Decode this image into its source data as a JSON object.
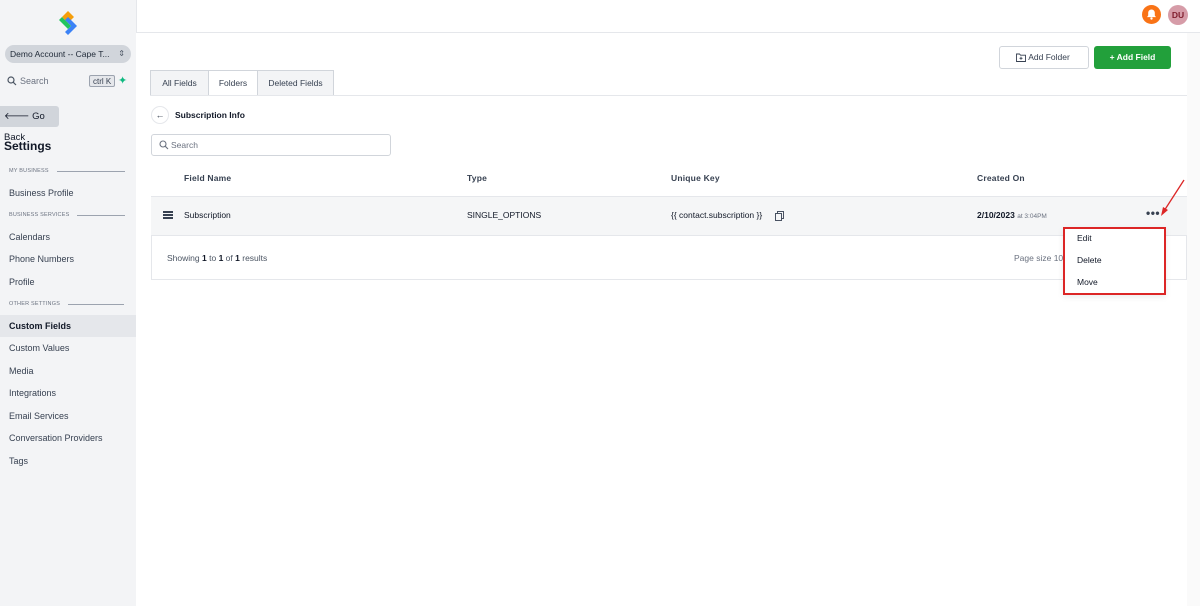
{
  "sidebar": {
    "account_name": "Demo Account -- Cape T...",
    "search_placeholder": "Search",
    "search_shortcut": "ctrl K",
    "go_back": "Go Back",
    "settings_title": "Settings",
    "sections": {
      "my_business": "MY BUSINESS",
      "business_services": "BUSINESS SERVICES",
      "other_settings": "OTHER SETTINGS"
    },
    "items": [
      {
        "label": "Business Profile"
      },
      {
        "label": "Calendars"
      },
      {
        "label": "Phone Numbers"
      },
      {
        "label": "Profile"
      },
      {
        "label": "Custom Fields"
      },
      {
        "label": "Custom Values"
      },
      {
        "label": "Media"
      },
      {
        "label": "Integrations"
      },
      {
        "label": "Email Services"
      },
      {
        "label": "Conversation Providers"
      },
      {
        "label": "Tags"
      }
    ],
    "active_item": "Custom Fields"
  },
  "topbar": {
    "avatar_initials": "DU",
    "bell_icon": "bell-icon",
    "colors": {
      "bell": "#f97316",
      "avatar": "#d69ca8"
    }
  },
  "header": {
    "add_folder": "Add Folder",
    "add_field": "+ Add Field",
    "accent": "#22a03b"
  },
  "tabs": [
    {
      "label": "All Fields"
    },
    {
      "label": "Folders"
    },
    {
      "label": "Deleted Fields"
    }
  ],
  "active_tab": "Folders",
  "breadcrumb": {
    "title": "Subscription Info"
  },
  "search": {
    "placeholder": "Search",
    "value": ""
  },
  "table": {
    "columns": [
      "Field Name",
      "Type",
      "Unique Key",
      "Created On"
    ],
    "rows": [
      {
        "field_name": "Subscription",
        "type": "SINGLE_OPTIONS",
        "unique_key": "{{ contact.subscription }}",
        "created_date": "2/10/2023",
        "created_time": "at 3:04PM"
      }
    ],
    "footer": {
      "showing_prefix": "Showing",
      "from": "1",
      "to_word": "to",
      "to": "1",
      "of_word": "of",
      "total": "1",
      "results_word": "results",
      "page_size": "Page size 10"
    }
  },
  "row_menu": {
    "items": [
      "Edit",
      "Delete",
      "Move"
    ],
    "highlight_color": "#dc2626"
  }
}
